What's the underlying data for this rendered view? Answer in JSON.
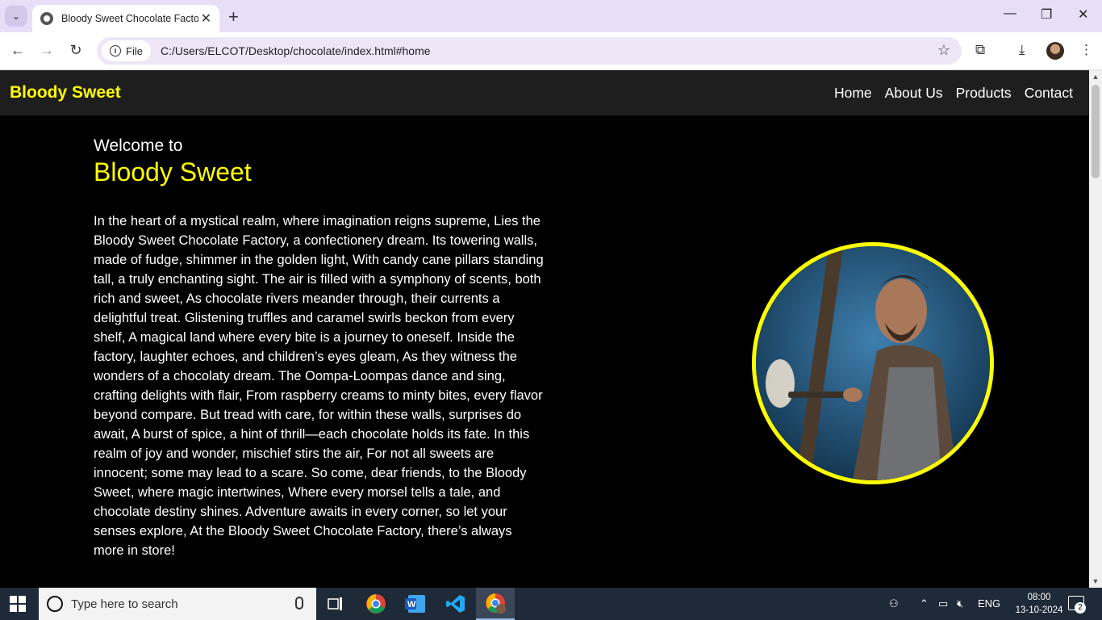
{
  "browser": {
    "tab_title": "Bloody Sweet Chocolate Factory",
    "site_chip_label": "File",
    "url": "C:/Users/ELCOT/Desktop/chocolate/index.html#home"
  },
  "site": {
    "brand": "Bloody Sweet",
    "nav": [
      "Home",
      "About Us",
      "Products",
      "Contact"
    ],
    "welcome": "Welcome to",
    "hero_title": "Bloody Sweet",
    "hero_body": "In the heart of a mystical realm, where imagination reigns supreme, Lies the Bloody Sweet Chocolate Factory, a confectionery dream. Its towering walls, made of fudge, shimmer in the golden light, With candy cane pillars standing tall, a truly enchanting sight. The air is filled with a symphony of scents, both rich and sweet, As chocolate rivers meander through, their currents a delightful treat. Glistening truffles and caramel swirls beckon from every shelf, A magical land where every bite is a journey to oneself. Inside the factory, laughter echoes, and children’s eyes gleam, As they witness the wonders of a chocolaty dream. The Oompa-Loompas dance and sing, crafting delights with flair, From raspberry creams to minty bites, every flavor beyond compare. But tread with care, for within these walls, surprises do await, A burst of spice, a hint of thrill—each chocolate holds its fate. In this realm of joy and wonder, mischief stirs the air, For not all sweets are innocent; some may lead to a scare. So come, dear friends, to the Bloody Sweet, where magic intertwines, Where every morsel tells a tale, and chocolate destiny shines. Adventure awaits in every corner, so let your senses explore, At the Bloody Sweet Chocolate Factory, there’s always more in store!",
    "accent_color": "#ffff00"
  },
  "taskbar": {
    "search_placeholder": "Type here to search",
    "language": "ENG",
    "time": "08:00",
    "date": "13-10-2024",
    "notification_count": "2"
  }
}
